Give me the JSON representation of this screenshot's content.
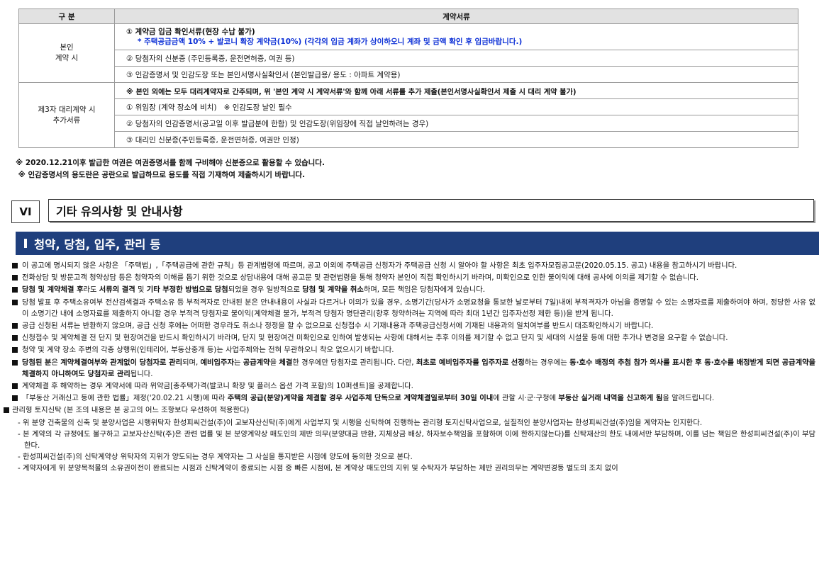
{
  "table": {
    "header_col1": "구  분",
    "header_col2": "계약서류",
    "self": {
      "label_line1": "본인",
      "label_line2": "계약 시",
      "item1_line1": "① 계약금 입금 확인서류(현장 수납 불가)",
      "item1_line2": "* 주택공급금액 10% + 발코니 확장 계약금(10%) (각각의 입금 계좌가 상이하오니 계좌 및 금액 확인 후 입금바랍니다.)",
      "item2": "② 당첨자의 신분증 (주민등록증, 운전면허증, 여권 등)",
      "item3": "③ 인감증명서 및 인감도장 또는 본인서명사실확인서 (본인발급용/ 용도 : 아파트 계약용)"
    },
    "proxy": {
      "label_line1": "제3자 대리계약 시",
      "label_line2": "추가서류",
      "note": "※ 본인 외에는 모두 대리계약자로 간주되며, 위 '본인 계약 시 계약서류'와 함께 아래 서류를 추가 제출(본인서명사실확인서 제출 시 대리 계약 불가)",
      "item1": "① 위임장 (계약 장소에 비치)   ※ 인감도장 날인 필수",
      "item2": "② 당첨자의 인감증명서(공고일 이후 발급분에 한함) 및 인감도장(위임장에 직접 날인하려는 경우)",
      "item3": "③ 대리인 신분증(주민등록증, 운전면허증, 여권만 인정)"
    }
  },
  "notes": [
    "※ 2020.12.21이후 발급한 여권은 여권증명서를 함께 구비해야 신분증으로 활용할 수 있습니다.",
    " ※ 인감증명서의 용도란은 공란으로 발급하므로 용도를 직접 기재하여 제출하시기 바랍니다."
  ],
  "section": {
    "number": "VI",
    "title": "기타 유의사항 및 안내사항",
    "subtitle": "청약, 당첨, 입주, 관리 등"
  },
  "items": {
    "i1": "이 공고에 명시되지 않은 사항은 「주택법」,「주택공급에 관한 규칙」등 관계법령에 따르며, 공고 이외에 주택공급 신청자가 주택공급 신청 시 알아야 할 사항은 최초 입주자모집공고문(2020.05.15. 공고) 내용을 참고하시기 바랍니다.",
    "i2": "전화상담 및 방문고객 청약상담 등은 청약자의 이해를 돕기 위한 것으로 상담내용에 대해 공고문 및 관련법령을 통해 청약자 본인이 직접 확인하시기 바라며, 미확인으로 인한 불이익에 대해 공사에 이의를 제기할 수 없습니다.",
    "i3_a": "당첨 및 계약체결 후",
    "i3_b": "라도 ",
    "i3_c": "서류의 결격",
    "i3_d": " 및 ",
    "i3_e": "기타 부정한 방법으로 당첨",
    "i3_f": "되었을 경우 일방적으로 ",
    "i3_g": "당첨 및 계약을 취소",
    "i3_h": "하며, 모든 책임은 당첨자에게 있습니다.",
    "i4": "당첨 발표 후 주택소유여부 전산검색결과 주택소유 등 부적격자로 안내된 분은 안내내용이 사실과 다르거나 이의가 있을 경우, 소명기간(당사가 소명요청을 통보한 날로부터 7일)내에 부적격자가 아님을 증명할 수 있는 소명자료를 제출하여야 하며, 정당한 사유 없이 소명기간 내에 소명자료를 제출하지 아니할 경우 부적격 당첨자로 불이익(계약체결 불가, 부적격 당첨자 명단관리(향후 청약하려는 지역에 따라 최대 1년간 입주자선정 제한 등))을 받게 됩니다.",
    "i5": "공급 신청된 서류는 반환하지 않으며, 공급 신청 후에는 어떠한 경우라도 취소나 정정을 할 수 없으므로 신청접수 시 기재내용과 주택공급신청서에 기재된 내용과의 일치여부를 반드시 대조확인하시기 바랍니다.",
    "i6": "신청접수 및 계약체결 전 단지 및 현장여건을 반드시 확인하시기 바라며, 단지 및 현장여건 미확인으로 인하여 발생되는 사항에 대해서는 추후 이의를 제기할 수 없고 단지 및 세대의 시설물 등에 대한 추가나 변경을 요구할 수 없습니다.",
    "i7": "청약 및 계약 장소 주변의 각종 상행위(인테리어, 부동산중개 등)는 사업주체와는 전혀 무관하오니 착오 없으시기 바랍니다.",
    "i8_a": "당첨된 분",
    "i8_b": "은 ",
    "i8_c": "계약체결여부와 관계없이 당첨자로 관리",
    "i8_d": "되며, ",
    "i8_e": "예비입주자",
    "i8_f": "는 ",
    "i8_g": "공급계약",
    "i8_h": "을 ",
    "i8_i": "체결",
    "i8_j": "한 경우에만 당첨자로 관리됩니다. 다만, ",
    "i8_k": "최초로 예비입주자를 입주자로 선정",
    "i8_l": "하는 경우에는 ",
    "i8_m": "동·호수 배정의 추첨 참가 의사를 표시한 후 동·호수를 배정받게 되면 공급계약을 체결하지 아니하여도 당첨자로 관리",
    "i8_n": "됩니다.",
    "i9": "계약체결 후 해약하는 경우 계약서에 따라 위약금[총주택가격(발코니 확장 및 플러스 옵션 가격 포함)의 10퍼센트]을 공제합니다.",
    "i10_a": "「부동산 거래신고 등에 관한 법률」제정('20.02.21 시행)에 따라 ",
    "i10_b": "주택의 공급(분양)계약을 체결할 경우 사업주체 단독으로 계약체결일로부터 30일 이내",
    "i10_c": "에 관할 시·군·구청에 ",
    "i10_d": "부동산 실거래 내역을 신고하게 됨",
    "i10_e": "을 알려드립니다.",
    "trust_title": "관리형 토지신탁 (본 조의 내용은 본 공고의 어느 조항보다 우선하여 적용한다)",
    "trust_1": "- 위 분양 건축물의 신축 및 분양사업은 시행위탁자 한성피씨건설(주)이 교보자산신탁(주)에게 사업부지 및 시행을 신탁하여 진행하는 관리형 토지신탁사업으로, 실질적인 분양사업자는 한성피씨건설(주)임을 계약자는 인지한다.",
    "trust_2": "- 본 계약의 각 규정에도 불구하고 교보자산신탁(주)은 관련 법률 및 본 분양계약상 매도인의 제반 의무(분양대금 반환, 지체상금 배상, 하자보수책임을 포함하며 이에 한하지않는다)를 신탁재산의 한도 내에서만 부담하며, 이를 넘는 책임은 한성피씨건설(주)이 부담한다.",
    "trust_3": "- 한성피씨건설(주)의 신탁계약상 위탁자의 지위가 양도되는 경우 계약자는 그 사실을 통지받은 시점에 양도에 동의한 것으로 본다.",
    "trust_4": "- 계약자에게 위 분양목적물의 소유권이전이 완료되는 시점과 신탁계약이 종료되는 시점 중 빠른 시점에, 본 계약상 매도인의 지위 및 수탁자가 부담하는 제반 권리의무는 계약변경등 별도의 조치 없이"
  },
  "colors": {
    "band_bg": "#1f3f7d",
    "blue_text": "#0b2fd6",
    "table_header_bg": "#e2e2e2"
  }
}
